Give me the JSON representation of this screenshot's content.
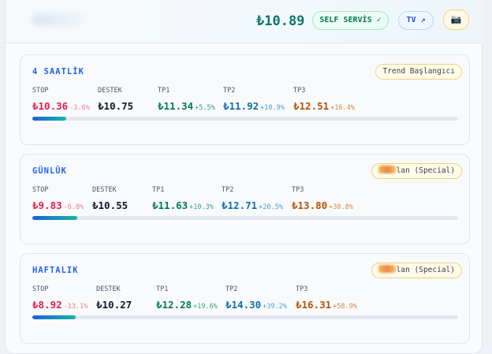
{
  "header": {
    "price": "₺10.89",
    "self_service_label": "SELF SERVİS ✓",
    "tv_label": "TV ↗",
    "camera_icon": "📷"
  },
  "cards": [
    {
      "title": "4 SAATLİK",
      "badge": "Trend Başlangıcı",
      "stop_label": "STOP",
      "stop": "₺10.36",
      "stop_pct": "-3.6%",
      "support_label": "DESTEK",
      "support": "₺10.75",
      "tp1_label": "TP1",
      "tp1": "₺11.34",
      "tp1_pct": "+5.5%",
      "tp2_label": "TP2",
      "tp2": "₺11.92",
      "tp2_pct": "+10.9%",
      "tp3_label": "TP3",
      "tp3": "₺12.51",
      "tp3_pct": "+16.4%",
      "progress": 0.08
    },
    {
      "title": "GÜNLÜK",
      "badge": "lan (Special)",
      "stop_label": "STOP",
      "stop": "₺9.83",
      "stop_pct": "-6.8%",
      "support_label": "DESTEK",
      "support": "₺10.55",
      "tp1_label": "TP1",
      "tp1": "₺11.63",
      "tp1_pct": "+10.3%",
      "tp2_label": "TP2",
      "tp2": "₺12.71",
      "tp2_pct": "+20.5%",
      "tp3_label": "TP3",
      "tp3": "₺13.80",
      "tp3_pct": "+30.8%",
      "progress": 0.105
    },
    {
      "title": "HAFTALIK",
      "badge": "lan (Special)",
      "stop_label": "STOP",
      "stop": "₺8.92",
      "stop_pct": "-13.1%",
      "support_label": "DESTEK",
      "support": "₺10.27",
      "tp1_label": "TP1",
      "tp1": "₺12.28",
      "tp1_pct": "+19.6%",
      "tp2_label": "TP2",
      "tp2": "₺14.30",
      "tp2_pct": "+39.2%",
      "tp3_label": "TP3",
      "tp3": "₺16.31",
      "tp3_pct": "+58.9%",
      "progress": 0.102
    }
  ]
}
